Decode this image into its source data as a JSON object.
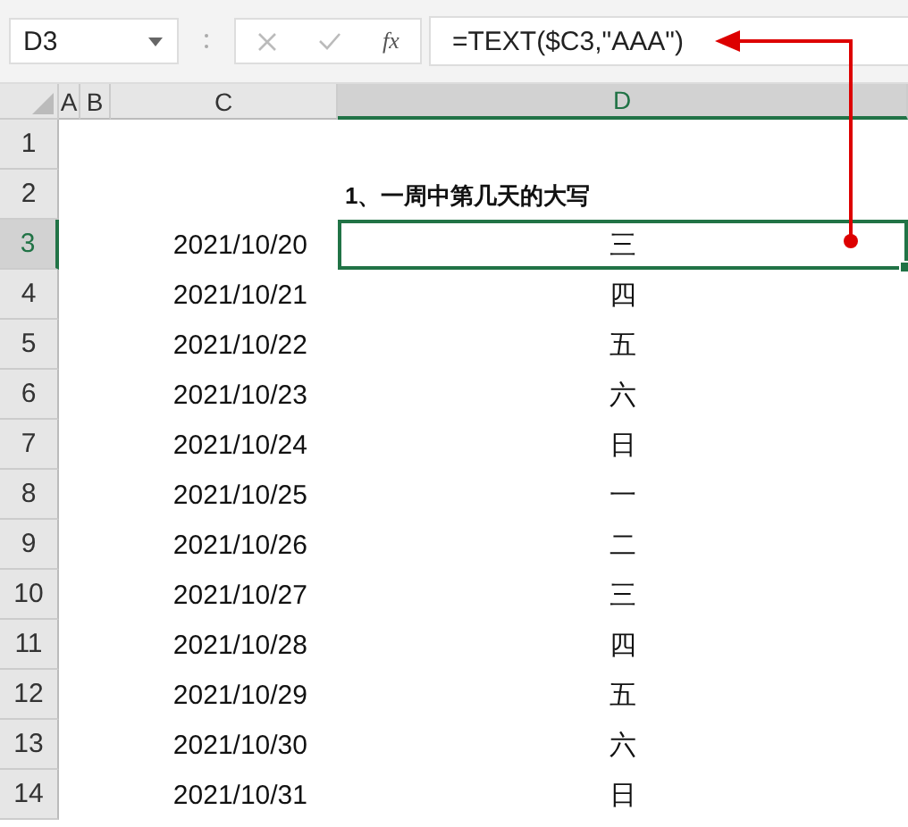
{
  "formula_bar": {
    "name_box": "D3",
    "function_label": "fx",
    "formula": "=TEXT($C3,\"AAA\")"
  },
  "columns": [
    {
      "label": "A",
      "selected": false
    },
    {
      "label": "B",
      "selected": false
    },
    {
      "label": "C",
      "selected": false
    },
    {
      "label": "D",
      "selected": true
    }
  ],
  "rows": [
    {
      "number": "1",
      "selected": false
    },
    {
      "number": "2",
      "selected": false,
      "kind": "title",
      "value": "1、一周中第几天的大写"
    },
    {
      "number": "3",
      "selected": true,
      "kind": "data",
      "date": "2021/10/20",
      "value": "三"
    },
    {
      "number": "4",
      "selected": false,
      "kind": "data",
      "date": "2021/10/21",
      "value": "四"
    },
    {
      "number": "5",
      "selected": false,
      "kind": "data",
      "date": "2021/10/22",
      "value": "五"
    },
    {
      "number": "6",
      "selected": false,
      "kind": "data",
      "date": "2021/10/23",
      "value": "六"
    },
    {
      "number": "7",
      "selected": false,
      "kind": "data",
      "date": "2021/10/24",
      "value": "日"
    },
    {
      "number": "8",
      "selected": false,
      "kind": "data",
      "date": "2021/10/25",
      "value": "一"
    },
    {
      "number": "9",
      "selected": false,
      "kind": "data",
      "date": "2021/10/26",
      "value": "二"
    },
    {
      "number": "10",
      "selected": false,
      "kind": "data",
      "date": "2021/10/27",
      "value": "三"
    },
    {
      "number": "11",
      "selected": false,
      "kind": "data",
      "date": "2021/10/28",
      "value": "四"
    },
    {
      "number": "12",
      "selected": false,
      "kind": "data",
      "date": "2021/10/29",
      "value": "五"
    },
    {
      "number": "13",
      "selected": false,
      "kind": "data",
      "date": "2021/10/30",
      "value": "六"
    },
    {
      "number": "14",
      "selected": false,
      "kind": "data",
      "date": "2021/10/31",
      "value": "日"
    }
  ]
}
